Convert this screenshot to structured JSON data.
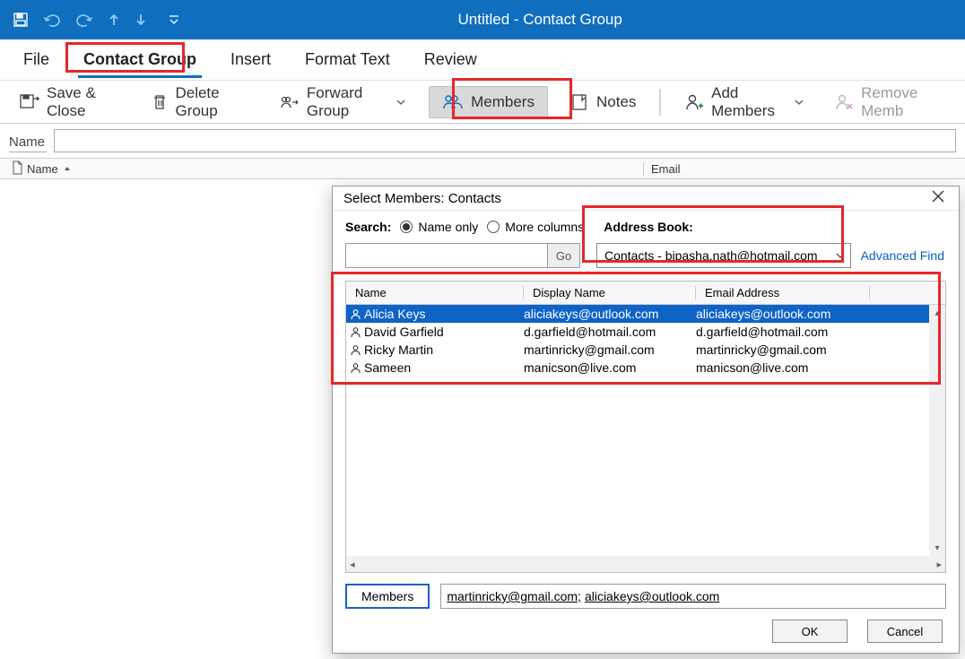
{
  "titlebar": {
    "title": "Untitled  -  Contact Group"
  },
  "menu": {
    "file": "File",
    "contact_group": "Contact Group",
    "insert": "Insert",
    "format_text": "Format Text",
    "review": "Review"
  },
  "ribbon": {
    "save_close": "Save & Close",
    "delete_group": "Delete Group",
    "forward_group": "Forward Group",
    "members": "Members",
    "notes": "Notes",
    "add_members": "Add Members",
    "remove_member": "Remove Memb"
  },
  "name_field": {
    "label": "Name",
    "value": ""
  },
  "main_columns": {
    "name": "Name",
    "email": "Email"
  },
  "dialog": {
    "title": "Select Members: Contacts",
    "search_label": "Search:",
    "radio_name": "Name only",
    "radio_more": "More columns",
    "address_book_label": "Address Book:",
    "go": "Go",
    "address_book_value": "Contacts - bipasha.nath@hotmail.com",
    "advanced": "Advanced Find",
    "columns": {
      "name": "Name",
      "display": "Display Name",
      "email": "Email Address"
    },
    "contacts": [
      {
        "name": "Alicia Keys",
        "display": "aliciakeys@outlook.com",
        "email": "aliciakeys@outlook.com",
        "selected": true
      },
      {
        "name": "David Garfield",
        "display": "d.garfield@hotmail.com",
        "email": "d.garfield@hotmail.com",
        "selected": false
      },
      {
        "name": "Ricky Martin",
        "display": "martinricky@gmail.com",
        "email": "martinricky@gmail.com",
        "selected": false
      },
      {
        "name": "Sameen",
        "display": "manicson@live.com",
        "email": "manicson@live.com",
        "selected": false
      }
    ],
    "members_btn": "Members",
    "members_value": [
      {
        "text": "martinricky@gmail.com;",
        "u": true
      },
      {
        "text": " ",
        "u": false
      },
      {
        "text": "aliciakeys@outlook.com",
        "u": true
      }
    ],
    "ok": "OK",
    "cancel": "Cancel"
  }
}
